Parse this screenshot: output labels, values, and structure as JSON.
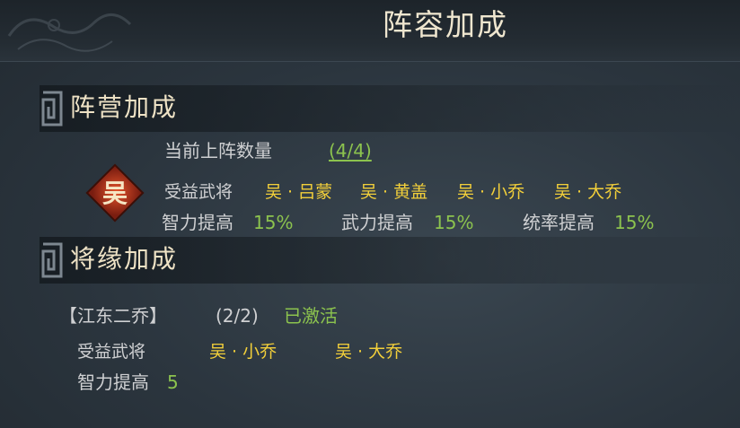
{
  "window": {
    "title": "阵容加成"
  },
  "faction_bonus": {
    "header": "阵营加成",
    "emblem_glyph": "吴",
    "count_label": "当前上阵数量",
    "count_value": "(4/4)",
    "beneficiary_label": "受益武将",
    "generals": [
      "吴 · 吕蒙",
      "吴 · 黄盖",
      "吴 · 小乔",
      "吴 · 大乔"
    ],
    "stats": [
      {
        "label": "智力提高",
        "value": "15%"
      },
      {
        "label": "武力提高",
        "value": "15%"
      },
      {
        "label": "统率提高",
        "value": "15%"
      }
    ]
  },
  "bond_bonus": {
    "header": "将缘加成",
    "bond_name": "【江东二乔】",
    "bond_progress": "(2/2)",
    "bond_status": "已激活",
    "beneficiary_label": "受益武将",
    "generals": [
      "吴 · 小乔",
      "吴 · 大乔"
    ],
    "stat_label": "智力提高",
    "stat_value": "5"
  },
  "colors": {
    "value_green": "#8cc34e",
    "general_gold": "#f2cf3a",
    "emblem_red": "#b8321c",
    "title_cream": "#efe6cf"
  },
  "icons": {
    "meander_frame": "meander-pattern-icon",
    "faction_emblem": "wu-faction-emblem-icon"
  }
}
